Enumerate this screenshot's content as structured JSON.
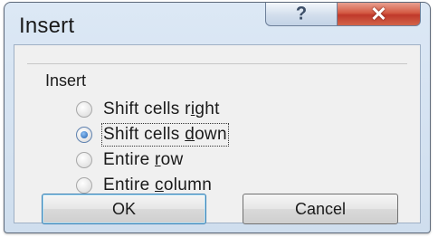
{
  "window": {
    "title": "Insert",
    "help_glyph": "?",
    "close_glyph": "✕"
  },
  "group": {
    "label": "Insert"
  },
  "options": [
    {
      "pre": "Shift cells r",
      "key": "i",
      "post": "ght",
      "checked": false
    },
    {
      "pre": "Shift cells ",
      "key": "d",
      "post": "own",
      "checked": true
    },
    {
      "pre": "Entire ",
      "key": "r",
      "post": "ow",
      "checked": false
    },
    {
      "pre": "Entire ",
      "key": "c",
      "post": "olumn",
      "checked": false
    }
  ],
  "buttons": {
    "ok": "OK",
    "cancel": "Cancel"
  }
}
